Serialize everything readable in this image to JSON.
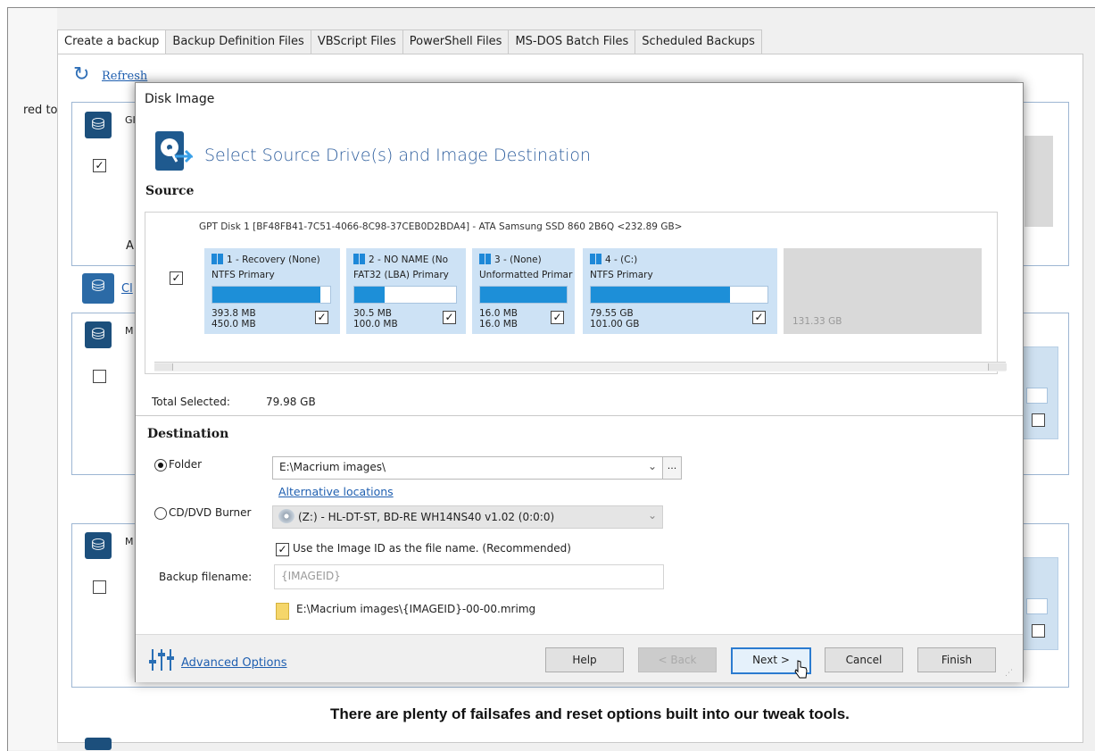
{
  "background": {
    "tabs": [
      "Create a backup",
      "Backup Definition Files",
      "VBScript Files",
      "PowerShell Files",
      "MS-DOS Batch Files",
      "Scheduled Backups"
    ],
    "refresh_label": "Refresh",
    "side_text": "red to",
    "disk1_label": "GI",
    "disk1_sub": "A",
    "clone_link": "Cl",
    "disk2_label": "M",
    "disk3_label": "M"
  },
  "dialog": {
    "title": "Disk Image",
    "header": "Select Source Drive(s) and Image Destination",
    "source_label": "Source",
    "disk_info": "GPT Disk 1 [BF48FB41-7C51-4066-8C98-37CEB0D2BDA4] - ATA     Samsung SSD 860  2B6Q  <232.89 GB>",
    "partitions": [
      {
        "name": "1 - Recovery (None)",
        "fs": "NTFS Primary",
        "fill": 0.92,
        "used": "393.8 MB",
        "total": "450.0 MB",
        "checked": true
      },
      {
        "name": "2 - NO NAME (No",
        "fs": "FAT32 (LBA) Primary",
        "fill": 0.3,
        "used": "30.5 MB",
        "total": "100.0 MB",
        "checked": true
      },
      {
        "name": "3 - (None)",
        "fs": "Unformatted Primary",
        "fill": 1.0,
        "used": "16.0 MB",
        "total": "16.0 MB",
        "checked": true
      },
      {
        "name": "4 - (C:)",
        "fs": "NTFS Primary",
        "fill": 0.79,
        "used": "79.55 GB",
        "total": "101.00 GB",
        "checked": true
      }
    ],
    "unallocated": "131.33 GB",
    "total_selected_label": "Total Selected:",
    "total_selected_value": "79.98 GB",
    "destination_label": "Destination",
    "folder_label": "Folder",
    "folder_value": "E:\\Macrium images\\",
    "browse_label": "...",
    "alt_locations": "Alternative locations",
    "cd_label": "CD/DVD Burner",
    "cd_value": "(Z:) - HL-DT-ST, BD-RE  WH14NS40  v1.02 (0:0:0)",
    "use_imageid_label": "Use the Image ID as the file name.  (Recommended)",
    "backup_filename_label": "Backup filename:",
    "backup_filename_value": "{IMAGEID}",
    "path_preview": "E:\\Macrium images\\{IMAGEID}-00-00.mrimg",
    "advanced_options": "Advanced Options",
    "buttons": {
      "help": "Help",
      "back": "< Back",
      "next": "Next >",
      "cancel": "Cancel",
      "finish": "Finish"
    }
  },
  "caption": "There are plenty of failsafes and reset options built into our tweak tools."
}
